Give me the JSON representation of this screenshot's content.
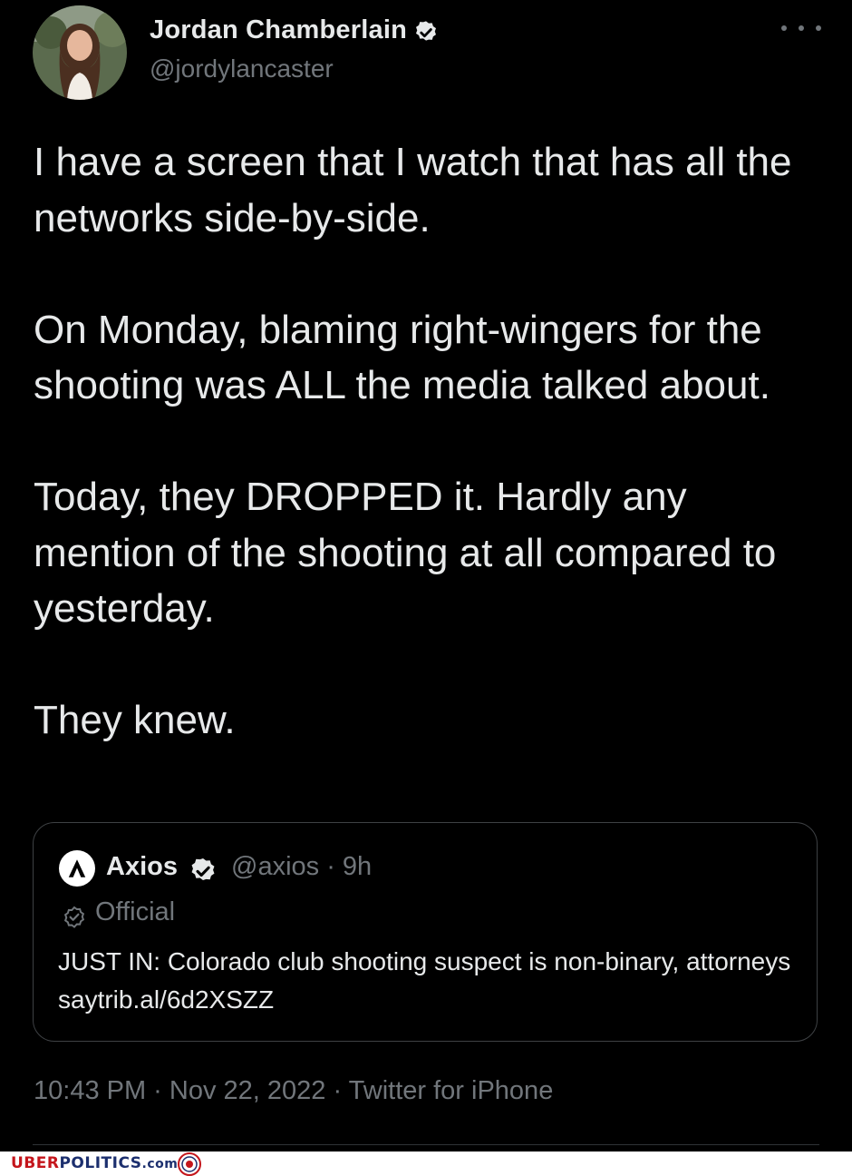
{
  "author": {
    "display_name": "Jordan Chamberlain",
    "handle": "@jordylancaster",
    "avatar_icon": "profile-photo",
    "verified_icon": "verified-badge-icon"
  },
  "tweet": {
    "paragraphs": [
      "I have a screen that I watch that has all the networks side-by-side.",
      "On Monday, blaming right-wingers for the shooting was ALL the media talked about.",
      "Today, they DROPPED it. Hardly any mention of the shooting at all compared to yesterday.",
      "They knew."
    ]
  },
  "quoted_tweet": {
    "name": "Axios",
    "handle_time": "@axios · 9h",
    "label": "Official",
    "text": "JUST IN: Colorado club shooting suspect is non-binary, attorneys saytrib.al/6d2XSZZ"
  },
  "metadata": {
    "timestamp_line": "10:43 PM · Nov 22, 2022 · Twitter for iPhone"
  },
  "watermark": {
    "part1": "UBER",
    "part2": "POLITICS",
    "part3": ".com"
  },
  "colors": {
    "background": "#000000",
    "text": "#e7e9ea",
    "secondary": "#71767b",
    "border": "#3e4144"
  }
}
